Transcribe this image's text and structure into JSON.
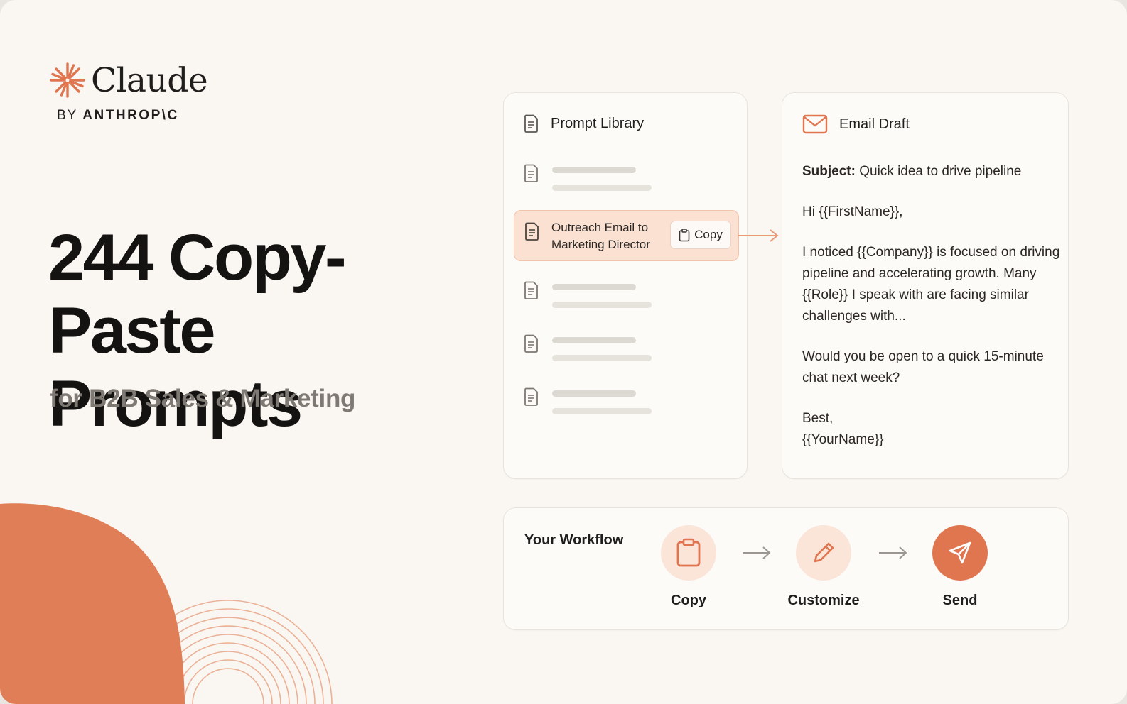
{
  "brand": {
    "name": "Claude",
    "by_prefix": "BY",
    "by_company": "ANTHROP\\C"
  },
  "hero": {
    "line1": "244 Copy-Paste",
    "line2": "Prompts",
    "subtitle": "for B2B Sales & Marketing"
  },
  "library": {
    "title": "Prompt Library",
    "selected_label": "Outreach Email to Marketing Director",
    "copy_label": "Copy"
  },
  "email": {
    "title": "Email Draft",
    "subject_label": "Subject:",
    "subject_value": "Quick idea to drive pipeline",
    "greeting": "Hi {{FirstName}},",
    "paragraph1": "I noticed {{Company}} is focused on driving pipeline and accelerating growth. Many {{Role}} I speak with are facing similar challenges with...",
    "paragraph2": "Would you be open to a quick 15-minute chat next week?",
    "signoff": "Best,",
    "signature": "{{YourName}}"
  },
  "workflow": {
    "title": "Your Workflow",
    "steps": [
      {
        "label": "Copy",
        "icon": "clipboard-icon"
      },
      {
        "label": "Customize",
        "icon": "pencil-icon"
      },
      {
        "label": "Send",
        "icon": "paper-plane-icon"
      }
    ]
  },
  "colors": {
    "accent": "#e0764f",
    "accent_light": "#fbe1d2",
    "background": "#faf7f3"
  }
}
